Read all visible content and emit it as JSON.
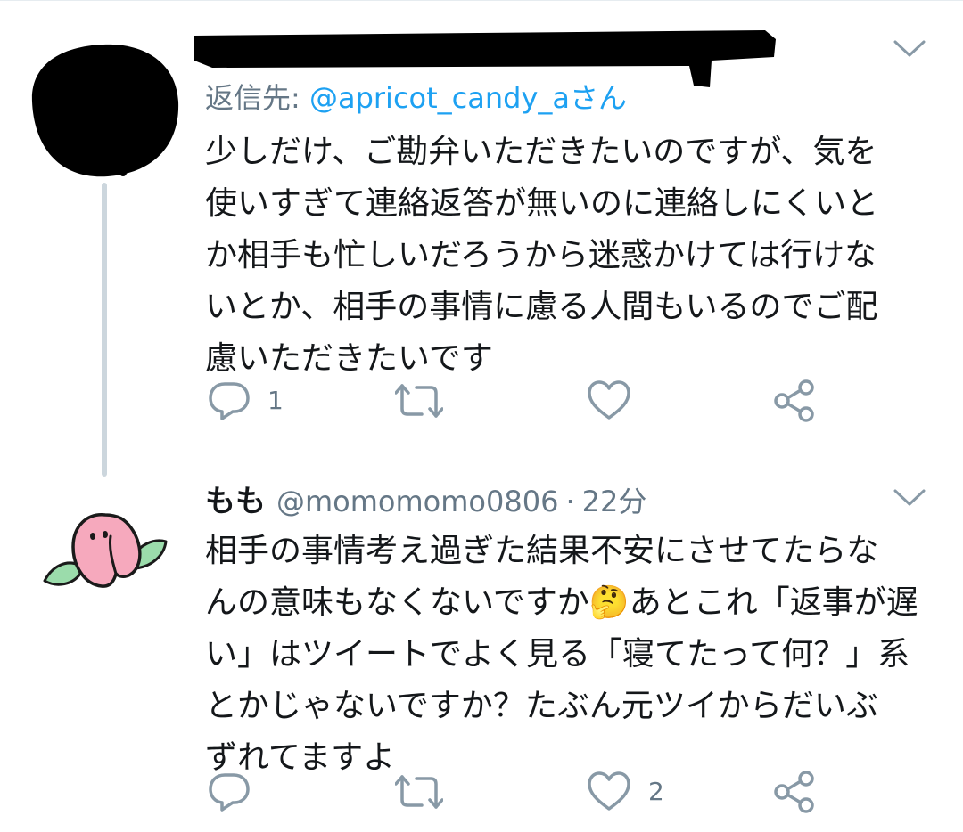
{
  "tweet1": {
    "reply_to_prefix": "返信先: ",
    "reply_to_handle": "@apricot_candy_aさん",
    "text_lines": [
      "少しだけ、ご勘弁いただきたいのですが、気を",
      "使いすぎて連絡返答が無いのに連絡しにくいと",
      "か相手も忙しいだろうから迷惑かけては行けな",
      "いとか、相手の事情に慮る人間もいるのでご配",
      "慮いただきたいです"
    ],
    "reply_count": "1",
    "retweet_count": "",
    "like_count": ""
  },
  "tweet2": {
    "author_name": "もも",
    "author_handle": "@momomomo0806",
    "separator": "·",
    "timestamp": "22分",
    "text_lines": [
      "相手の事情考え過ぎた結果不安にさせてたらな",
      "んの意味もなくないですか🤔あとこれ「返事が遅",
      "い」はツイートでよく見る「寝てたって何？」系",
      "とかじゃないですか？たぶん元ツイからだいぶ",
      "ずれてますよ"
    ],
    "reply_count": "",
    "retweet_count": "",
    "like_count": "2"
  },
  "icons": {
    "reply": "reply-icon",
    "retweet": "retweet-icon",
    "like": "heart-icon",
    "share": "share-icon",
    "menu": "chevron-down-icon"
  },
  "colors": {
    "text_primary": "#14171a",
    "text_secondary": "#657786",
    "link": "#1da1f2",
    "thread_line": "#ccd6dd",
    "peach_pink": "#f4a7b9",
    "leaf_green": "#8fd19e"
  }
}
